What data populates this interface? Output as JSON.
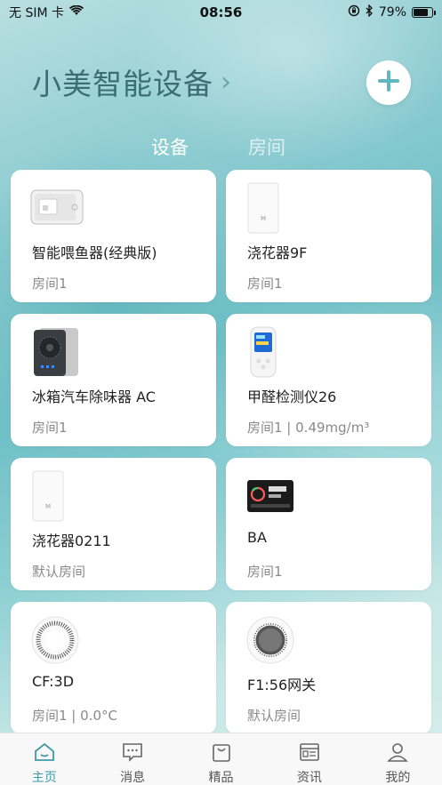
{
  "status_bar": {
    "carrier": "无 SIM 卡",
    "time": "08:56",
    "battery_percent": "79%",
    "battery_level": 0.79
  },
  "header": {
    "title": "小美智能设备",
    "chevron": "›",
    "add_icon": "plus-icon"
  },
  "tabs": [
    {
      "label": "设备",
      "active": true
    },
    {
      "label": "房间",
      "active": false
    }
  ],
  "devices": [
    {
      "name": "智能喂鱼器(经典版)",
      "room": "房间1",
      "icon": "fish-feeder-icon"
    },
    {
      "name": "浇花器9F",
      "room": "房间1",
      "icon": "plant-waterer-icon"
    },
    {
      "name": "冰箱汽车除味器 AC",
      "room": "房间1",
      "icon": "deodorizer-icon"
    },
    {
      "name": "甲醛检测仪26",
      "room": "房间1 | 0.49mg/m³",
      "icon": "formaldehyde-detector-icon"
    },
    {
      "name": "浇花器0211",
      "room": "默认房间",
      "icon": "plant-waterer-icon"
    },
    {
      "name": "BA",
      "room": "房间1",
      "icon": "air-monitor-icon"
    },
    {
      "name": "CF:3D",
      "room": "房间1 | 0.0°C",
      "icon": "sensor-disc-icon"
    },
    {
      "name": "F1:56网关",
      "room": "默认房间",
      "icon": "gateway-icon"
    }
  ],
  "tabbar": [
    {
      "label": "主页",
      "icon": "home-icon",
      "active": true
    },
    {
      "label": "消息",
      "icon": "message-icon",
      "active": false
    },
    {
      "label": "精品",
      "icon": "shopping-bag-icon",
      "active": false
    },
    {
      "label": "资讯",
      "icon": "news-icon",
      "active": false
    },
    {
      "label": "我的",
      "icon": "profile-icon",
      "active": false
    }
  ],
  "colors": {
    "accent": "#3d9aa5",
    "background": "#8fcdd2"
  }
}
